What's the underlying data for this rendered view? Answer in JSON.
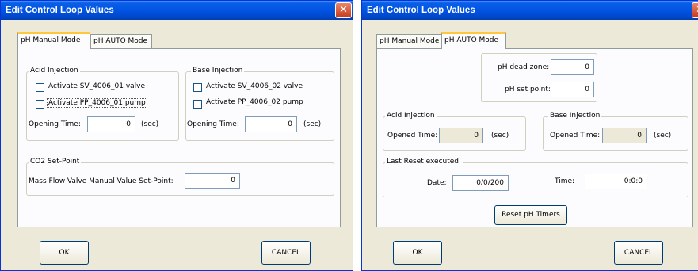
{
  "dialog_left": {
    "title": "Edit Control Loop Values",
    "tabs": [
      "pH Manual Mode",
      "pH AUTO Mode"
    ],
    "acid_injection": {
      "label": "Acid Injection",
      "valve_label": "Activate SV_4006_01 valve",
      "pump_label": "Activate PP_4006_01 pump",
      "opening_time_label": "Opening Time:",
      "opening_time_value": "0",
      "unit": "(sec)"
    },
    "base_injection": {
      "label": "Base Injection",
      "valve_label": "Activate SV_4006_02 valve",
      "pump_label": "Activate PP_4006_02 pump",
      "opening_time_label": "Opening Time:",
      "opening_time_value": "0",
      "unit": "(sec)"
    },
    "co2": {
      "label": "CO2 Set-Point",
      "field_label": "Mass Flow Valve Manual Value Set-Point:",
      "value": "0"
    },
    "ok_label": "OK",
    "cancel_label": "CANCEL"
  },
  "dialog_right": {
    "title": "Edit Control Loop Values",
    "tabs": [
      "pH Manual Mode",
      "pH AUTO Mode"
    ],
    "dead_zone_label": "pH dead zone:",
    "dead_zone_value": "0",
    "set_point_label": "pH set point:",
    "set_point_value": "0",
    "acid_injection": {
      "label": "Acid Injection",
      "opened_time_label": "Opened Time:",
      "opened_time_value": "0",
      "unit": "(sec)"
    },
    "base_injection": {
      "label": "Base Injection",
      "opened_time_label": "Opened Time:",
      "opened_time_value": "0",
      "unit": "(sec)"
    },
    "last_reset": {
      "label": "Last Reset executed:",
      "date_label": "Date:",
      "date_value": "0/0/200",
      "time_label": "Time:",
      "time_value": "0:0:0"
    },
    "reset_button_label": "Reset pH Timers",
    "ok_label": "OK",
    "cancel_label": "CANCEL"
  }
}
